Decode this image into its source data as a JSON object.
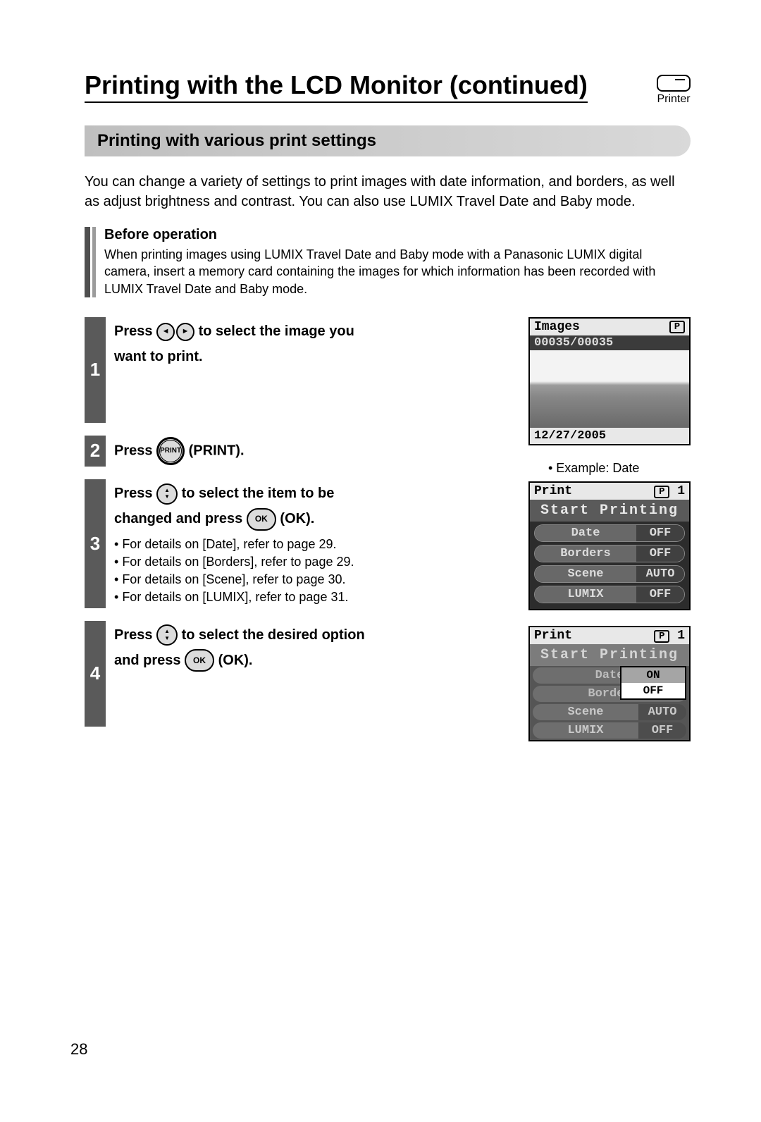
{
  "page_number": "28",
  "page_title": "Printing with the LCD Monitor (continued)",
  "printer_label": "Printer",
  "section_heading": "Printing with various print settings",
  "intro": "You can change a variety of settings to print images with date information, and borders, as well as adjust brightness and contrast. You can also use LUMIX Travel Date and Baby mode.",
  "before": {
    "heading": "Before operation",
    "text": "When printing images using LUMIX Travel Date and Baby mode with a Panasonic LUMIX digital camera, insert a memory card containing the images for which information has been recorded with LUMIX Travel Date and Baby mode."
  },
  "steps": {
    "s1": {
      "num": "1",
      "t1": "Press ",
      "t2": " to select the image you",
      "t3": "want to print."
    },
    "s2": {
      "num": "2",
      "t1": "Press ",
      "print_btn": "PRINT",
      "t2": " (PRINT)."
    },
    "s3": {
      "num": "3",
      "t1": "Press ",
      "t2": " to select the item to be",
      "t3": "changed and press ",
      "ok_btn": "OK",
      "t4": " (OK).",
      "b1": "For details on [Date], refer to page 29.",
      "b2": "For details on [Borders], refer to page 29.",
      "b3": "For details on [Scene], refer to page 30.",
      "b4": "For details on [LUMIX], refer to page 31."
    },
    "s4": {
      "num": "4",
      "t1": "Press ",
      "t2": " to select the desired option",
      "t3": "and press ",
      "ok_btn": "OK",
      "t4": " (OK)."
    }
  },
  "screen1": {
    "header": "Images",
    "p_icon": "P",
    "counter": "00035/00035",
    "date": "12/27/2005"
  },
  "example_label": "• Example: Date",
  "screen2": {
    "header": "Print",
    "p_icon": "P",
    "num": "1",
    "start": "Start Printing",
    "rows": [
      {
        "l": "Date",
        "r": "OFF"
      },
      {
        "l": "Borders",
        "r": "OFF"
      },
      {
        "l": "Scene",
        "r": "AUTO"
      },
      {
        "l": "LUMIX",
        "r": "OFF"
      }
    ]
  },
  "screen3": {
    "header": "Print",
    "p_icon": "P",
    "num": "1",
    "start": "Start Printing",
    "popup": [
      "ON",
      "OFF"
    ],
    "rows_dim": [
      {
        "l": "Date"
      },
      {
        "l": "Border"
      }
    ],
    "rows": [
      {
        "l": "Scene",
        "r": "AUTO"
      },
      {
        "l": "LUMIX",
        "r": "OFF"
      }
    ]
  }
}
